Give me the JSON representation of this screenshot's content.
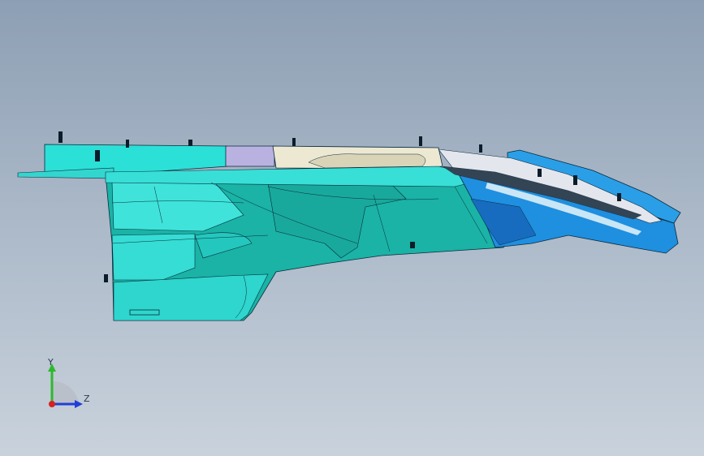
{
  "viewport": {
    "background_top": "#8d9fb4",
    "background_bottom": "#c9d2dc"
  },
  "model": {
    "colors": {
      "cyan": "#1fd6cf",
      "teal": "#1ab3a6",
      "lavender": "#b9b2e0",
      "cream": "#ece8d2",
      "blue": "#1f8fe0",
      "dark_blue": "#176cc0",
      "edge": "#0a2a3a"
    }
  },
  "triad": {
    "y_label": "Y",
    "z_label": "Z",
    "y_color": "#2fb82f",
    "z_color": "#1f3fd8",
    "origin_color": "#d82020"
  }
}
